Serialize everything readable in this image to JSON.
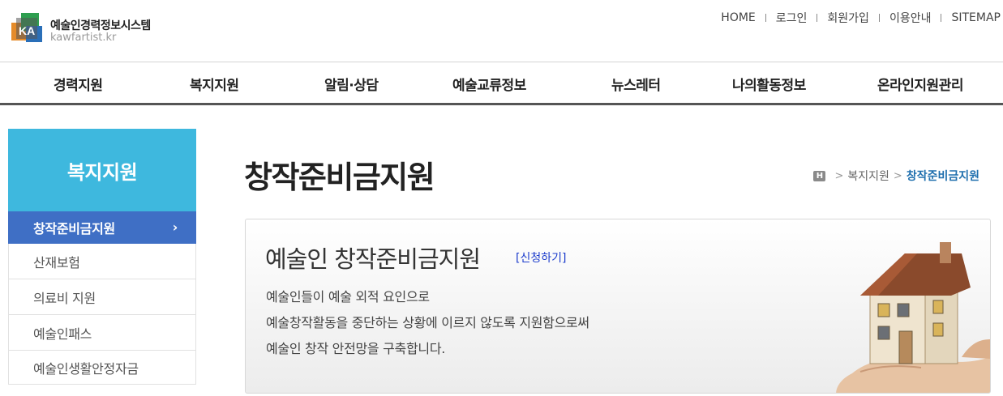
{
  "header": {
    "logo_title": "예술인경력정보시스템",
    "logo_sub": "kawfartist.kr",
    "logo_mark_text": "KA",
    "util_nav": [
      "HOME",
      "로그인",
      "회원가입",
      "이용안내",
      "SITEMAP"
    ]
  },
  "gnb": [
    "경력지원",
    "복지지원",
    "알림·상담",
    "예술교류정보",
    "뉴스레터",
    "나의활동정보",
    "온라인지원관리"
  ],
  "sidebar": {
    "title": "복지지원",
    "items": [
      {
        "label": "창작준비금지원",
        "active": true
      },
      {
        "label": "산재보험",
        "active": false
      },
      {
        "label": "의료비 지원",
        "active": false
      },
      {
        "label": "예술인패스",
        "active": false
      },
      {
        "label": "예술인생활안정자금",
        "active": false
      }
    ]
  },
  "page": {
    "title": "창작준비금지원",
    "breadcrumb": {
      "home_icon_text": "H",
      "items": [
        "복지지원",
        "창작준비금지원"
      ]
    }
  },
  "intro": {
    "title": "예술인 창작준비금지원",
    "apply_link": "[신청하기]",
    "lines": [
      "예술인들이 예술 외적 요인으로",
      "예술창작활동을 중단하는 상황에 이르지 않도록 지원함으로써",
      "예술인 창작 안전망을 구축합니다."
    ]
  },
  "colors": {
    "sidebar_title_bg": "#3eb8de",
    "sidebar_active_bg": "#3f6fc5",
    "apply_link": "#1d3dcc",
    "breadcrumb_current": "#1f6fae",
    "gnb_border": "#555555"
  }
}
